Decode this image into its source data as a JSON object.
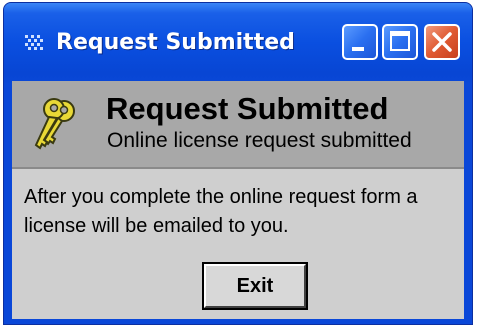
{
  "window": {
    "title": "Request Submitted",
    "app_icon": "grid-dots-icon",
    "controls": {
      "minimize_icon": "minimize-icon",
      "maximize_icon": "maximize-icon",
      "close_icon": "close-icon"
    }
  },
  "header": {
    "icon": "keys-icon",
    "title": "Request Submitted",
    "subtitle": "Online license request submitted"
  },
  "body": {
    "message": "After you complete the online request form a license will be emailed to you."
  },
  "actions": {
    "exit_label": "Exit"
  },
  "colors": {
    "titlebar": "#0a4fe0",
    "close_button": "#e05a32",
    "header_panel": "#a8a8a8",
    "client_background": "#cfcfcf",
    "key_icon": "#e8d836"
  }
}
